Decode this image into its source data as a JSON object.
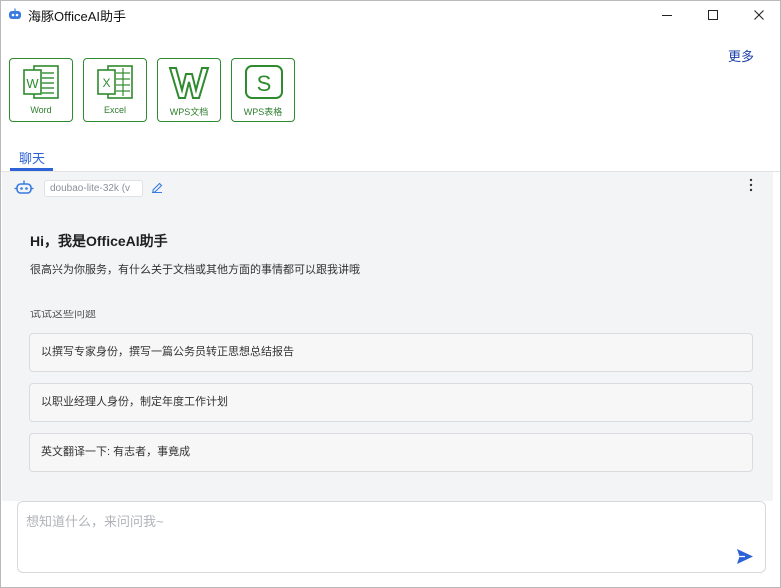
{
  "window": {
    "title": "海豚OfficeAI助手"
  },
  "header": {
    "more_label": "更多"
  },
  "apps": [
    {
      "label": "Word",
      "icon": "word-icon"
    },
    {
      "label": "Excel",
      "icon": "excel-icon"
    },
    {
      "label": "WPS文档",
      "icon": "wps-writer-icon"
    },
    {
      "label": "WPS表格",
      "icon": "wps-spreadsheet-icon"
    }
  ],
  "tabs": [
    {
      "label": "聊天",
      "active": true
    }
  ],
  "chat": {
    "model_name": "doubao-lite-32k (v",
    "greeting_title": "Hi，我是OfficeAI助手",
    "greeting_subtitle": "很高兴为你服务，有什么关于文档或其他方面的事情都可以跟我讲哦",
    "partial_heading": "试试这些问题",
    "suggestions": [
      "以撰写专家身份，撰写一篇公务员转正思想总结报告",
      "以职业经理人身份，制定年度工作计划",
      "英文翻译一下: 有志者，事竟成"
    ]
  },
  "input": {
    "placeholder": "想知道什么，来问问我~",
    "value": ""
  },
  "colors": {
    "accent": "#2d63d6",
    "app_green": "#2e8b2e",
    "link_blue": "#1a3fa8"
  }
}
